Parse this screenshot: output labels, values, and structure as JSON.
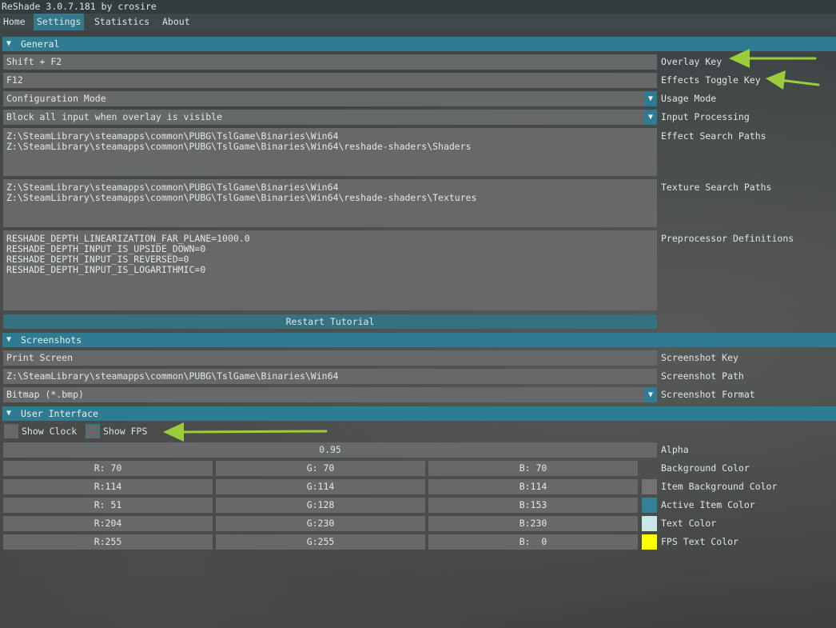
{
  "title": "ReShade 3.0.7.181 by crosire",
  "menu": [
    {
      "label": "Home"
    },
    {
      "label": "Settings"
    },
    {
      "label": "Statistics"
    },
    {
      "label": "About"
    }
  ],
  "general": {
    "header": "General",
    "overlay_key": {
      "value": "Shift + F2",
      "label": "Overlay Key"
    },
    "effects_toggle_key": {
      "value": "F12",
      "label": "Effects Toggle Key"
    },
    "usage_mode": {
      "value": "Configuration Mode",
      "label": "Usage Mode"
    },
    "input_processing": {
      "value": "Block all input when overlay is visible",
      "label": "Input Processing"
    },
    "effect_search_paths": {
      "value": "Z:\\SteamLibrary\\steamapps\\common\\PUBG\\TslGame\\Binaries\\Win64\nZ:\\SteamLibrary\\steamapps\\common\\PUBG\\TslGame\\Binaries\\Win64\\reshade-shaders\\Shaders",
      "label": "Effect Search Paths"
    },
    "texture_search_paths": {
      "value": "Z:\\SteamLibrary\\steamapps\\common\\PUBG\\TslGame\\Binaries\\Win64\nZ:\\SteamLibrary\\steamapps\\common\\PUBG\\TslGame\\Binaries\\Win64\\reshade-shaders\\Textures",
      "label": "Texture Search Paths"
    },
    "preprocessor_definitions": {
      "value": "RESHADE_DEPTH_LINEARIZATION_FAR_PLANE=1000.0\nRESHADE_DEPTH_INPUT_IS_UPSIDE_DOWN=0\nRESHADE_DEPTH_INPUT_IS_REVERSED=0\nRESHADE_DEPTH_INPUT_IS_LOGARITHMIC=0",
      "label": "Preprocessor Definitions"
    },
    "restart_tutorial": "Restart Tutorial"
  },
  "screenshots": {
    "header": "Screenshots",
    "key": {
      "value": "Print Screen",
      "label": "Screenshot Key"
    },
    "path": {
      "value": "Z:\\SteamLibrary\\steamapps\\common\\PUBG\\TslGame\\Binaries\\Win64",
      "label": "Screenshot Path"
    },
    "format": {
      "value": "Bitmap (*.bmp)",
      "label": "Screenshot Format"
    }
  },
  "ui": {
    "header": "User Interface",
    "show_clock": {
      "label": "Show Clock",
      "checked": false
    },
    "show_fps": {
      "label": "Show FPS",
      "checked": true
    },
    "alpha": {
      "value": "0.95",
      "label": "Alpha"
    },
    "colors": [
      {
        "r": "R: 70",
        "g": "G: 70",
        "b": "B: 70",
        "label": "Background Color",
        "hex": "#464646"
      },
      {
        "r": "R:114",
        "g": "G:114",
        "b": "B:114",
        "label": "Item Background Color",
        "hex": "#727272"
      },
      {
        "r": "R: 51",
        "g": "G:128",
        "b": "B:153",
        "label": "Active Item Color",
        "hex": "#338099"
      },
      {
        "r": "R:204",
        "g": "G:230",
        "b": "B:230",
        "label": "Text Color",
        "hex": "#cce6e6"
      },
      {
        "r": "R:255",
        "g": "G:255",
        "b": "B:  0",
        "label": "FPS Text Color",
        "hex": "#ffff00"
      }
    ]
  },
  "icons": {
    "collapse": "triangle-down-icon",
    "dropdown": "triangle-down-icon",
    "annotation": "green-arrow-icon"
  },
  "colors": {
    "accent": "#2f7b91",
    "annotation": "#9ccc3c"
  }
}
